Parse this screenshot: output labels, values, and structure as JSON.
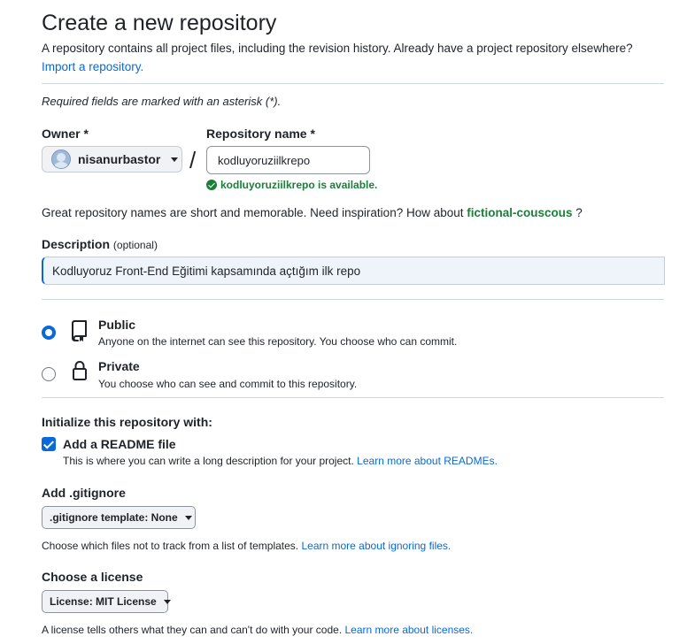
{
  "header": {
    "title": "Create a new repository",
    "subtitle": "A repository contains all project files, including the revision history. Already have a project repository elsewhere?",
    "import_link": "Import a repository."
  },
  "required_note": "Required fields are marked with an asterisk (*).",
  "owner": {
    "label": "Owner *",
    "value": "nisanurbastor"
  },
  "slash": "/",
  "repo_name": {
    "label": "Repository name *",
    "value": "kodluyoruziilkrepo",
    "availability": "kodluyoruziilkrepo is available."
  },
  "inspiration": {
    "text": "Great repository names are short and memorable. Need inspiration? How about",
    "suggestion": "fictional-couscous",
    "suffix": "?"
  },
  "description": {
    "label": "Description",
    "optional": "(optional)",
    "value": "Kodluyoruz Front-End Eğitimi kapsamında açtığım ilk repo"
  },
  "visibility": {
    "public": {
      "title": "Public",
      "desc": "Anyone on the internet can see this repository. You choose who can commit.",
      "selected": true
    },
    "private": {
      "title": "Private",
      "desc": "You choose who can see and commit to this repository.",
      "selected": false
    }
  },
  "init": {
    "title": "Initialize this repository with:",
    "readme": {
      "label": "Add a README file",
      "checked": true,
      "help": "This is where you can write a long description for your project.",
      "help_link": "Learn more about READMEs."
    }
  },
  "gitignore": {
    "title": "Add .gitignore",
    "select": ".gitignore template: None",
    "help": "Choose which files not to track from a list of templates.",
    "help_link": "Learn more about ignoring files."
  },
  "license": {
    "title": "Choose a license",
    "select": "License: MIT License",
    "help": "A license tells others what they can and can't do with your code.",
    "help_link": "Learn more about licenses."
  },
  "colors": {
    "accent": "#0969da",
    "success": "#1a7f37",
    "text": "#1f2328",
    "border": "#d0d7de"
  },
  "icons": [
    "caret-down-icon",
    "check-circle-icon",
    "repo-icon",
    "lock-icon",
    "checkbox-check-icon"
  ]
}
